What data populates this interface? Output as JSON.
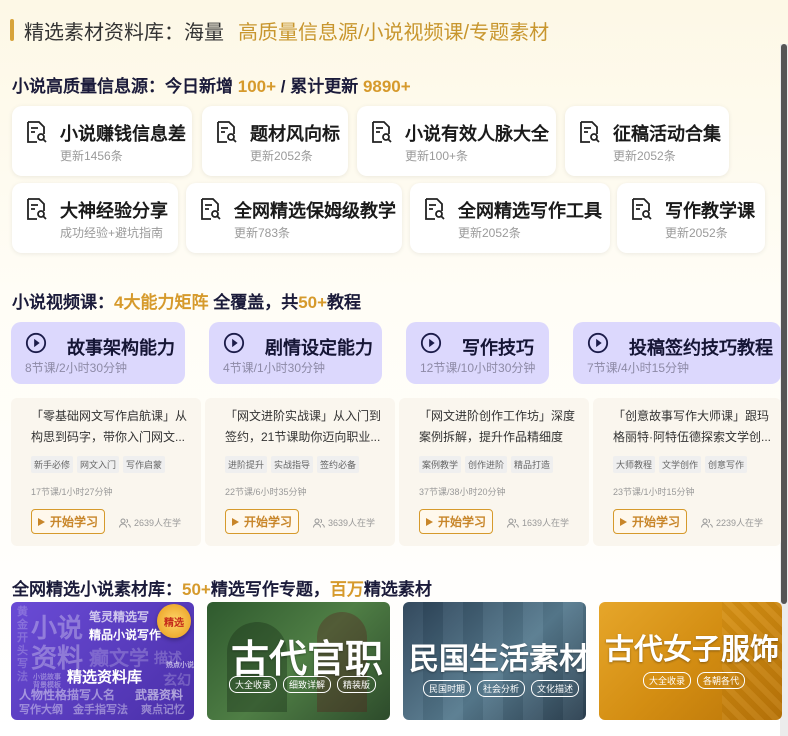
{
  "header": {
    "title": "精选素材资料库：海量",
    "subtitle": "高质量信息源/小说视频课/专题素材"
  },
  "info_section": {
    "prefix": "小说高质量信息源：今日新增 ",
    "today": "100+",
    "mid": " / 累计更新 ",
    "total": "9890+"
  },
  "info_cards": [
    {
      "title": "小说赚钱信息差",
      "sub": "更新1456条"
    },
    {
      "title": "题材风向标",
      "sub": "更新2052条"
    },
    {
      "title": "小说有效人脉大全",
      "sub": "更新100+条"
    },
    {
      "title": "征稿活动合集",
      "sub": "更新2052条"
    },
    {
      "title": "大神经验分享",
      "sub": "成功经验+避坑指南"
    },
    {
      "title": "全网精选保姆级教学",
      "sub": "更新783条"
    },
    {
      "title": "全网精选写作工具",
      "sub": "更新2052条"
    },
    {
      "title": "写作教学课",
      "sub": "更新2052条"
    }
  ],
  "video_section": {
    "prefix": "小说视频课：",
    "hl1": "4大能力矩阵",
    "mid": " 全覆盖，共",
    "hl2": "50+",
    "suffix": "教程"
  },
  "video_tabs": [
    {
      "title": "故事架构能力",
      "sub": "8节课/2小时30分钟"
    },
    {
      "title": "剧情设定能力",
      "sub": "4节课/1小时30分钟"
    },
    {
      "title": "写作技巧",
      "sub": "12节课/10小时30分钟"
    },
    {
      "title": "投稿签约技巧教程",
      "sub": "7节课/4小时15分钟"
    }
  ],
  "courses": [
    {
      "desc": "「零基础网文写作启航课」从构思到码字，带你入门网文...",
      "tags": [
        "新手必修",
        "网文入门",
        "写作启蒙"
      ],
      "meta": "17节课/1小时27分钟",
      "button": "开始学习",
      "learners": "2639人在学"
    },
    {
      "desc": "「网文进阶实战课」从入门到签约，21节课助你迈向职业...",
      "tags": [
        "进阶提升",
        "实战指导",
        "签约必备"
      ],
      "meta": "22节课/6小时35分钟",
      "button": "开始学习",
      "learners": "3639人在学"
    },
    {
      "desc": "「网文进阶创作工作坊」深度案例拆解，提升作品精细度",
      "tags": [
        "案例教学",
        "创作进阶",
        "精品打造"
      ],
      "meta": "37节课/38小时20分钟",
      "button": "开始学习",
      "learners": "1639人在学"
    },
    {
      "desc": "「创意故事写作大师课」跟玛格丽特·阿特伍德探索文学创...",
      "tags": [
        "大师教程",
        "文学创作",
        "创意写作"
      ],
      "meta": "23节课/1小时15分钟",
      "button": "开始学习",
      "learners": "2239人在学"
    }
  ],
  "material_section": {
    "prefix": "全网精选小说素材库：",
    "hl1": "50+",
    "mid": "精选写作专题，",
    "hl2": "百万",
    "suffix": "精选素材"
  },
  "materials": [
    {
      "title": "精选资料库",
      "badge": "精选",
      "bg_words": [
        "黄金开头写法",
        "小说",
        "资料",
        "笔灵精选写",
        "精品小说写作",
        "癫文学",
        "描述",
        "热点小说",
        "玄幻",
        "人物性格描写人名",
        "武器资料",
        "写作大纲",
        "金手指写法",
        "爽点记忆",
        "小说故事",
        "背景模板"
      ]
    },
    {
      "title": "古代官职",
      "pills": [
        "大全收录",
        "细致详解",
        "精装版"
      ]
    },
    {
      "title": "民国生活素材",
      "pills": [
        "民国时期",
        "社会分析",
        "文化描述"
      ]
    },
    {
      "title": "古代女子服饰",
      "pills": [
        "大全收录",
        "各朝各代"
      ]
    }
  ],
  "colors": {
    "accent": "#d69a2c",
    "video_tab_bg": "#dcd8fd",
    "course_bg": "#faf6ee",
    "mat1": "#5a3fc4",
    "mat2": "#3c6b3d",
    "mat3": "#37546a",
    "mat4": "#d89312"
  }
}
